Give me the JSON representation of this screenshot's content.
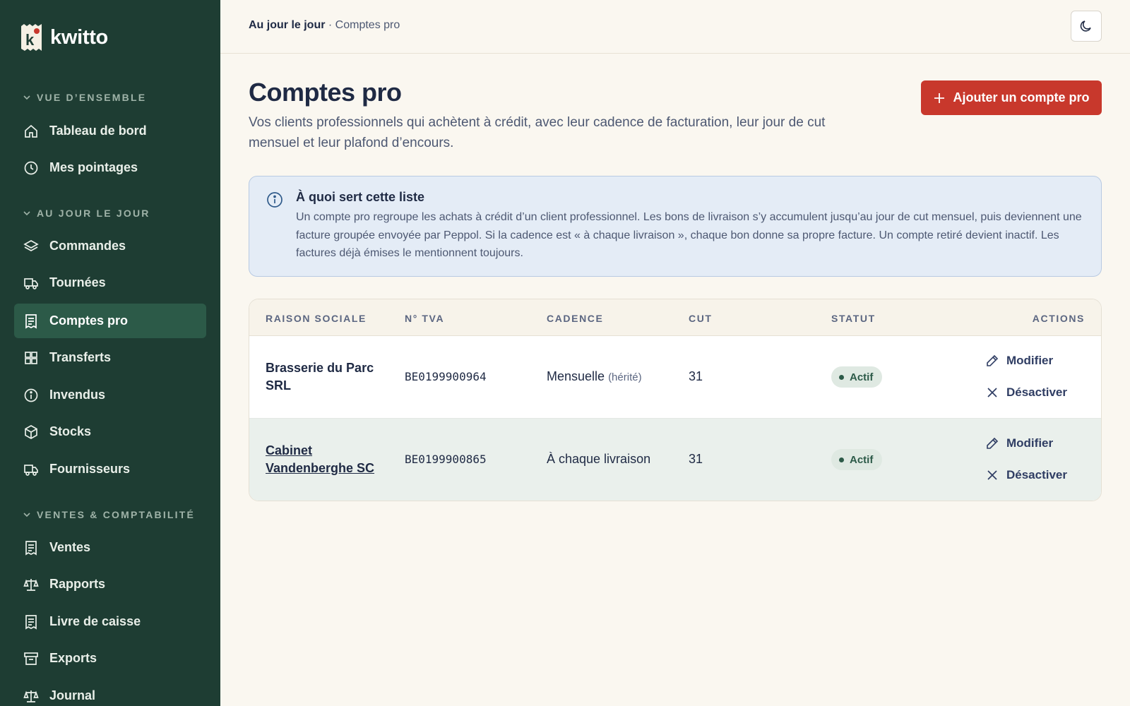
{
  "app": {
    "name": "kwitto"
  },
  "sidebar": {
    "sections": [
      {
        "title": "VUE D’ENSEMBLE"
      },
      {
        "title": "AU JOUR LE JOUR"
      },
      {
        "title": "VENTES & COMPTABILITÉ"
      }
    ],
    "items": [
      {
        "label": "Tableau de bord",
        "icon": "home-icon"
      },
      {
        "label": "Mes pointages",
        "icon": "clock-icon"
      },
      {
        "label": "Commandes",
        "icon": "layers-icon"
      },
      {
        "label": "Tournées",
        "icon": "truck-icon"
      },
      {
        "label": "Comptes pro",
        "icon": "receipt-icon",
        "active": true
      },
      {
        "label": "Transferts",
        "icon": "grid-icon"
      },
      {
        "label": "Invendus",
        "icon": "info-icon"
      },
      {
        "label": "Stocks",
        "icon": "box-icon"
      },
      {
        "label": "Fournisseurs",
        "icon": "truck-icon"
      },
      {
        "label": "Ventes",
        "icon": "receipt-icon"
      },
      {
        "label": "Rapports",
        "icon": "scale-icon"
      },
      {
        "label": "Livre de caisse",
        "icon": "receipt-icon"
      },
      {
        "label": "Exports",
        "icon": "archive-icon"
      },
      {
        "label": "Journal",
        "icon": "scale-icon"
      }
    ]
  },
  "header": {
    "breadcrumb_parent": "Au jour le jour",
    "breadcrumb_separator": " · ",
    "breadcrumb_current": "Comptes pro",
    "theme_toggle_icon": "moon-icon"
  },
  "main": {
    "title": "Comptes pro",
    "description": "Vos clients professionnels qui achètent à crédit, avec leur cadence de facturation, leur jour de cut mensuel et leur plafond d’encours.",
    "add_button": "Ajouter un compte pro",
    "info": {
      "title": "À quoi sert cette liste",
      "text": "Un compte pro regroupe les achats à crédit d’un client professionnel. Les bons de livraison s’y accumulent jusqu’au jour de cut mensuel, puis deviennent une facture groupée envoyée par Peppol. Si la cadence est « à chaque livraison », chaque bon donne sa propre facture. Un compte retiré devient inactif. Les factures déjà émises le mentionnent toujours."
    },
    "table": {
      "columns": [
        "RAISON SOCIALE",
        "N° TVA",
        "CADENCE",
        "CUT",
        "STATUT",
        "ACTIONS"
      ],
      "rows": [
        {
          "name": "Brasserie du Parc SRL",
          "vat": "BE0199900964",
          "cadence": "Mensuelle",
          "cadence_hint": "(hérité)",
          "cut": "31",
          "status": "Actif",
          "edit": "Modifier",
          "deactivate": "Désactiver"
        },
        {
          "name": "Cabinet Vandenberghe SC",
          "vat": "BE0199900865",
          "cadence": "À chaque livraison",
          "cadence_hint": "",
          "cut": "31",
          "status": "Actif",
          "edit": "Modifier",
          "deactivate": "Désactiver"
        }
      ]
    }
  },
  "colors": {
    "sidebar_bg": "#1e3d33",
    "active_item": "#2c5a48",
    "page_bg": "#faf7f0",
    "accent_red": "#c8382c",
    "info_bg": "#e4ecf6",
    "status_green": "#2c5a48"
  }
}
